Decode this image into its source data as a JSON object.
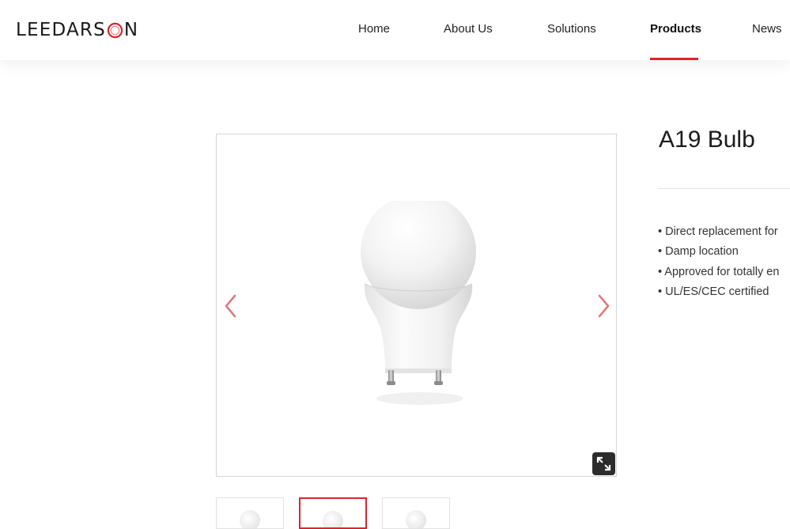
{
  "header": {
    "logo_text_before": "LEEDARS",
    "logo_text_after": "N",
    "nav": [
      {
        "label": "Home",
        "active": false
      },
      {
        "label": "About Us",
        "active": false
      },
      {
        "label": "Solutions",
        "active": false
      },
      {
        "label": "Products",
        "active": true
      },
      {
        "label": "News",
        "active": false
      }
    ]
  },
  "product": {
    "title": "A19 Bulb",
    "features": [
      "• Direct replacement for",
      "• Damp location",
      "• Approved for totally en",
      "• UL/ES/CEC certified"
    ]
  },
  "gallery": {
    "thumbnail_count": 3,
    "active_thumbnail": 2,
    "icons": {
      "prev": "chevron-left-icon",
      "next": "chevron-right-icon",
      "expand": "expand-icon"
    }
  },
  "colors": {
    "accent": "#d6262d",
    "arrow": "#e07a7a",
    "text": "#222222",
    "border": "#d6d6d6"
  }
}
